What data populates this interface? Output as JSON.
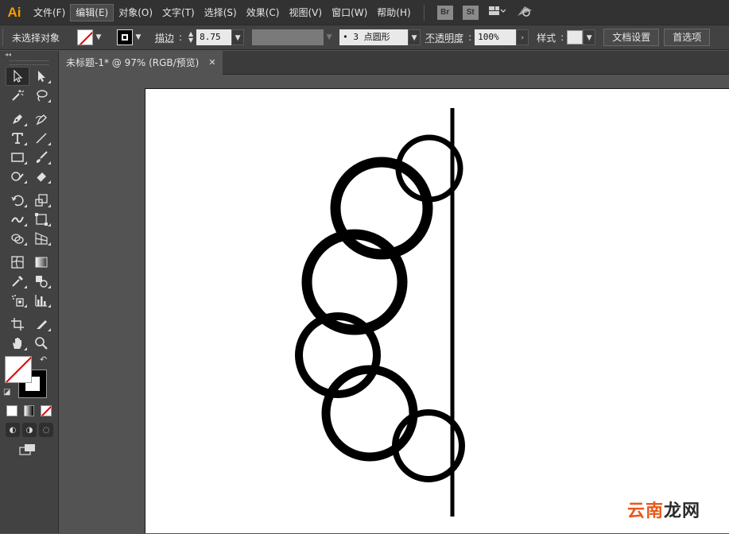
{
  "app": {
    "logo": "Ai"
  },
  "menubar": {
    "items": [
      "文件(F)",
      "编辑(E)",
      "对象(O)",
      "文字(T)",
      "选择(S)",
      "效果(C)",
      "视图(V)",
      "窗口(W)",
      "帮助(H)"
    ],
    "active_index": 1,
    "bridge": "Br",
    "stock": "St"
  },
  "controlbar": {
    "selection_status": "未选择对象",
    "stroke_label": "描边",
    "stroke_value": "8.75 p",
    "brush_label": "3 点圆形",
    "opacity_label": "不透明度",
    "opacity_value": "100%",
    "style_label": "样式",
    "doc_setup_button": "文档设置",
    "preferences_button": "首选项"
  },
  "document": {
    "tab_title": "未标题-1* @ 97% (RGB/预览)",
    "close_glyph": "✕"
  },
  "watermark": {
    "part1": "云南",
    "part2": "龙网"
  },
  "colors": {
    "menubar_bg": "#323232",
    "panel_bg": "#424242",
    "canvas_bg": "#535353",
    "artboard_bg": "#ffffff",
    "logo": "#ff9a00",
    "none_slash": "#dd0000"
  },
  "icons": {
    "tools": [
      [
        "selection-tool-icon",
        "direct-selection-tool-icon"
      ],
      [
        "magic-wand-tool-icon",
        "lasso-tool-icon"
      ],
      [
        "pen-tool-icon",
        "curvature-tool-icon"
      ],
      [
        "type-tool-icon",
        "line-segment-tool-icon"
      ],
      [
        "rectangle-tool-icon",
        "paintbrush-tool-icon"
      ],
      [
        "shaper-tool-icon",
        "eraser-tool-icon"
      ],
      [
        "rotate-tool-icon",
        "scale-tool-icon"
      ],
      [
        "width-tool-icon",
        "free-transform-tool-icon"
      ],
      [
        "shape-builder-tool-icon",
        "perspective-grid-tool-icon"
      ],
      [
        "mesh-tool-icon",
        "gradient-tool-icon"
      ],
      [
        "eyedropper-tool-icon",
        "blend-tool-icon"
      ],
      [
        "symbol-sprayer-tool-icon",
        "column-graph-tool-icon"
      ],
      [
        "artboard-tool-icon",
        "slice-tool-icon"
      ],
      [
        "hand-tool-icon",
        "zoom-tool-icon"
      ]
    ]
  }
}
